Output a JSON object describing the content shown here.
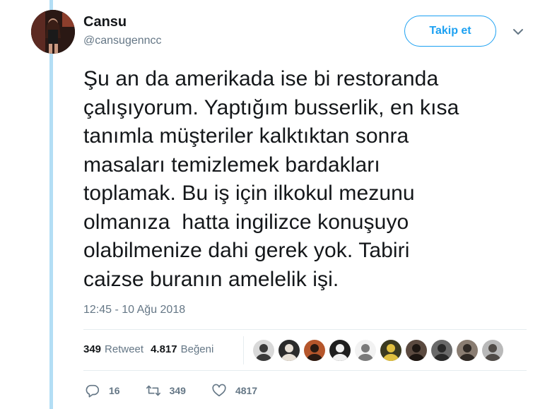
{
  "user": {
    "name": "Cansu",
    "handle": "@cansugenncc"
  },
  "follow_button": {
    "label": "Takip et"
  },
  "tweet": {
    "lines": [
      "Şu an da amerikada ise bi restoranda",
      "çalışıyorum. Yaptığım busserlik, en kısa",
      "tanımla müşteriler kalktıktan sonra",
      "masaları temizlemek bardakları",
      "toplamak. Bu iş için ilkokul mezunu",
      "olmanıza  hatta ingilizce konuşuyo",
      "olabilmenize dahi gerek yok. Tabiri",
      "caizse buranın amelelik işi."
    ],
    "timestamp": "12:45 - 10 Ağu 2018"
  },
  "stats": {
    "retweets_count": "349",
    "retweets_label": "Retweet",
    "likes_count": "4.817",
    "likes_label": "Beğeni"
  },
  "likers": [
    {
      "icon": "avatar-1",
      "bg": "#d9d9d9",
      "fg": "#3a3a3a"
    },
    {
      "icon": "avatar-2",
      "bg": "#2b2b2b",
      "fg": "#e8e0d6"
    },
    {
      "icon": "avatar-3",
      "bg": "#b5562b",
      "fg": "#2a1a12"
    },
    {
      "icon": "avatar-4",
      "bg": "#1e1e1e",
      "fg": "#f0f0f0"
    },
    {
      "icon": "avatar-5",
      "bg": "#f2f2f2",
      "fg": "#7a7a7a"
    },
    {
      "icon": "avatar-6",
      "bg": "#3b3a20",
      "fg": "#e0c040"
    },
    {
      "icon": "avatar-7",
      "bg": "#5b4a40",
      "fg": "#1d1612"
    },
    {
      "icon": "avatar-8",
      "bg": "#6a6a6a",
      "fg": "#2a2a2a"
    },
    {
      "icon": "avatar-9",
      "bg": "#8a7d72",
      "fg": "#2f2925"
    },
    {
      "icon": "avatar-10",
      "bg": "#b9b9b9",
      "fg": "#504b47"
    }
  ],
  "actions": {
    "reply_count": "16",
    "retweet_count": "349",
    "like_count": "4817"
  },
  "colors": {
    "accent": "#1da1f2",
    "muted": "#657786",
    "thread_line": "#b3def5"
  }
}
